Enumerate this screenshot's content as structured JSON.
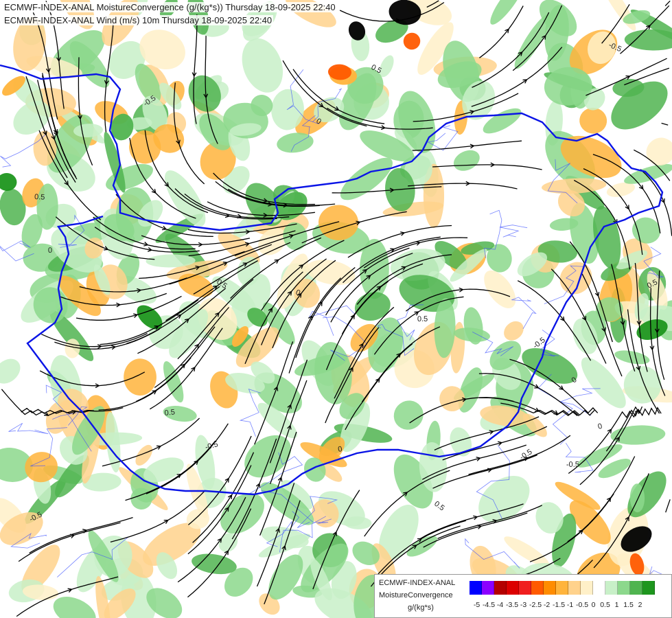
{
  "header": {
    "line1": "ECMWF-INDEX-ANAL MoistureConvergence (g/(kg*s)) Thursday 18-09-2025 22:40",
    "line2": "ECMWF-INDEX-ANAL Wind (m/s) 10m Thursday 18-09-2025 22:40"
  },
  "legend": {
    "source": "ECMWF-INDEX-ANAL",
    "variable": "MoistureConvergence",
    "unit": "g/(kg*s)",
    "ticks": [
      "-5",
      "-4.5",
      "-4",
      "-3.5",
      "-3",
      "-2.5",
      "-2",
      "-1.5",
      "-1",
      "-0.5",
      "0",
      "0.5",
      "1",
      "1.5",
      "2"
    ],
    "colors": [
      "#0000ff",
      "#8b00ff",
      "#b40000",
      "#dc0000",
      "#f01e1e",
      "#ff5a00",
      "#ff8c00",
      "#ffb43c",
      "#ffd28c",
      "#fff0c8",
      "#ffffff",
      "#c8f0c8",
      "#8cd88c",
      "#50b450",
      "#1e961e"
    ]
  },
  "map": {
    "contour_labels": [
      "-0.5",
      "0",
      "0.5",
      "-0.5",
      "0.5",
      "0",
      "-0.5",
      "0",
      "0.5",
      "-0.5",
      "0",
      "0.5",
      "-0.5",
      "0",
      "-0.5",
      "0.5",
      "-0.5",
      "0.5",
      "0",
      "-0.5"
    ],
    "colors": {
      "border": "#0a14e6",
      "river": "#3c50ff",
      "streamline": "#000000",
      "green_light": "#c8f0c8",
      "green_mid": "#8cd88c",
      "green_dark": "#50b450",
      "green_deep": "#1e961e",
      "orange_light": "#fff0c8",
      "orange_mid": "#ffd28c",
      "orange_dark": "#ffb43c",
      "red": "#ff5a00",
      "black": "#000000"
    }
  }
}
